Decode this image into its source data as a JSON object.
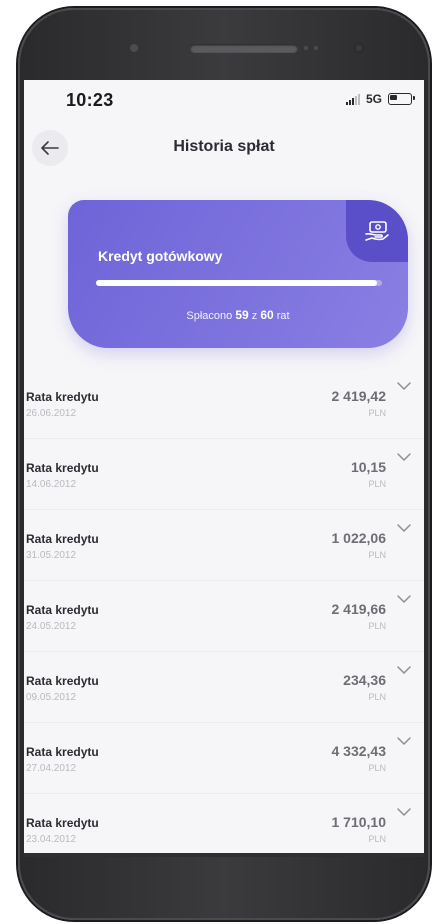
{
  "status_bar": {
    "time": "10:23",
    "network": "5G"
  },
  "header": {
    "title": "Historia spłat"
  },
  "loan_card": {
    "name": "Kredyt gotówkowy",
    "progress_prefix": "Spłacono",
    "paid": "59",
    "connector": "z",
    "total": "60",
    "progress_suffix": "rat",
    "progress_fraction": 0.983,
    "icon": "cash-hand-icon",
    "accent_color": "#6e64d8"
  },
  "payments": [
    {
      "title": "Rata kredytu",
      "date": "26.06.2012",
      "amount": "2 419,42",
      "currency": "PLN"
    },
    {
      "title": "Rata kredytu",
      "date": "14.06.2012",
      "amount": "10,15",
      "currency": "PLN"
    },
    {
      "title": "Rata kredytu",
      "date": "31.05.2012",
      "amount": "1 022,06",
      "currency": "PLN"
    },
    {
      "title": "Rata kredytu",
      "date": "24.05.2012",
      "amount": "2 419,66",
      "currency": "PLN"
    },
    {
      "title": "Rata kredytu",
      "date": "09.05.2012",
      "amount": "234,36",
      "currency": "PLN"
    },
    {
      "title": "Rata kredytu",
      "date": "27.04.2012",
      "amount": "4 332,43",
      "currency": "PLN"
    },
    {
      "title": "Rata kredytu",
      "date": "23.04.2012",
      "amount": "1 710,10",
      "currency": "PLN"
    }
  ]
}
